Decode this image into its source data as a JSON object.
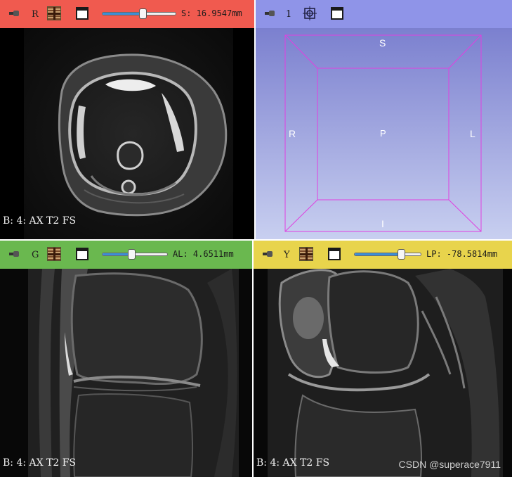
{
  "views": {
    "red": {
      "label": "R",
      "slice_value": "S: 16.9547mm",
      "slider_position": 0.55,
      "corner_text": "B: 4: AX T2 FS",
      "bar_color": "#f05a4f"
    },
    "three_d": {
      "label": "1",
      "bar_color": "#8f94e8",
      "orientation": {
        "top": "S",
        "left": "R",
        "right": "L",
        "center": "P",
        "bottom": "I"
      },
      "background_top": "#7b80cf",
      "background_bottom": "#c8cff0",
      "box_color": "#e040e0"
    },
    "green": {
      "label": "G",
      "slice_value": "AL: 4.6511mm",
      "slider_position": 0.45,
      "corner_text": "B: 4: AX T2 FS",
      "bar_color": "#6ab84f"
    },
    "yellow": {
      "label": "Y",
      "slice_value": "LP: -78.5814mm",
      "slider_position": 0.7,
      "corner_text": "B: 4: AX T2 FS",
      "bar_color": "#e8d44c"
    }
  },
  "icons": {
    "pin": "pin-icon",
    "link": "link-slice-icon",
    "center_3d": "center-view-icon",
    "layout": "view-layout-icon"
  },
  "watermark": "CSDN @superace7911"
}
